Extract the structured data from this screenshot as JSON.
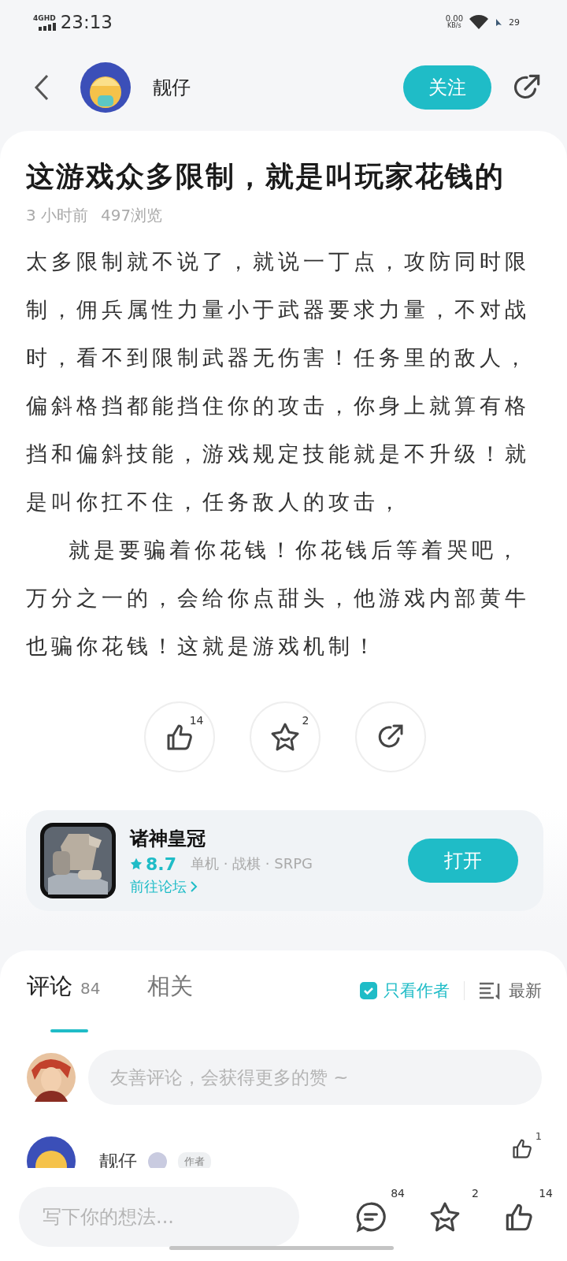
{
  "status_bar": {
    "network": "4GHD",
    "time": "23:13",
    "speed": "0.00",
    "speed_unit": "KB/s",
    "battery": "29"
  },
  "header": {
    "author": "靓仔",
    "follow_button": "关注",
    "following": false
  },
  "post": {
    "title": "这游戏众多限制，就是叫玩家花钱的",
    "meta": [
      "3 小时前",
      "497浏览"
    ],
    "paragraphs": [
      {
        "text": "太多限制就不说了，就说一丁点，攻防同时限制，佣兵属性力量小于武器要求力量，不对战时，看不到限制武器无伤害！任务里的敌人，偏斜格挡都能挡住你的攻击，你身上就算有格挡和偏斜技能，游戏规定技能就是不升级！就是叫你扛不住，任务敌人的攻击，",
        "indent": false
      },
      {
        "text": "就是要骗着你花钱！你花钱后等着哭吧，万分之一的，会给你点甜头，他游戏内部黄牛也骗你花钱！这就是游戏机制！",
        "indent": true
      }
    ],
    "actions": [
      {
        "kind": "like",
        "count": "14"
      },
      {
        "kind": "favorite",
        "count": "2"
      },
      {
        "kind": "share"
      }
    ]
  },
  "game": {
    "name": "诸神皇冠",
    "rating": "8.7",
    "tags": "单机 · 战棋 · SRPG",
    "forum_link": "前往论坛",
    "open_button": "打开"
  },
  "comments": {
    "tabs": [
      {
        "label": "评论",
        "count": "84",
        "selected": true
      },
      {
        "label": "相关",
        "selected": false
      }
    ],
    "author_only": {
      "label": "只看作者",
      "checked": true
    },
    "sort": "最新",
    "input_placeholder": "友善评论，会获得更多的赞 ~",
    "first_comment": {
      "name": "靓仔",
      "badge": "作者",
      "likes": "1"
    }
  },
  "bottom_bar": {
    "placeholder": "写下你的想法...",
    "actions": [
      {
        "kind": "comment",
        "count": "84"
      },
      {
        "kind": "favorite",
        "count": "2"
      },
      {
        "kind": "like",
        "count": "14"
      }
    ]
  }
}
